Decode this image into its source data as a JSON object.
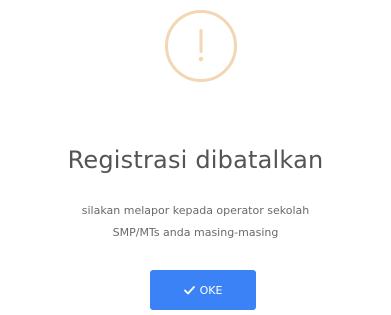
{
  "dialog": {
    "icon": "exclamation-icon",
    "title": "Registrasi dibatalkan",
    "message_line_1": "silakan melapor kepada operator sekolah",
    "message_line_2": "SMP/MTs anda masing-masing",
    "ok_button": {
      "icon": "check-icon",
      "label": "OKE"
    }
  },
  "colors": {
    "icon_ring": "#f3d6b3",
    "title_text": "#545454",
    "button_bg": "#3b82f6"
  }
}
